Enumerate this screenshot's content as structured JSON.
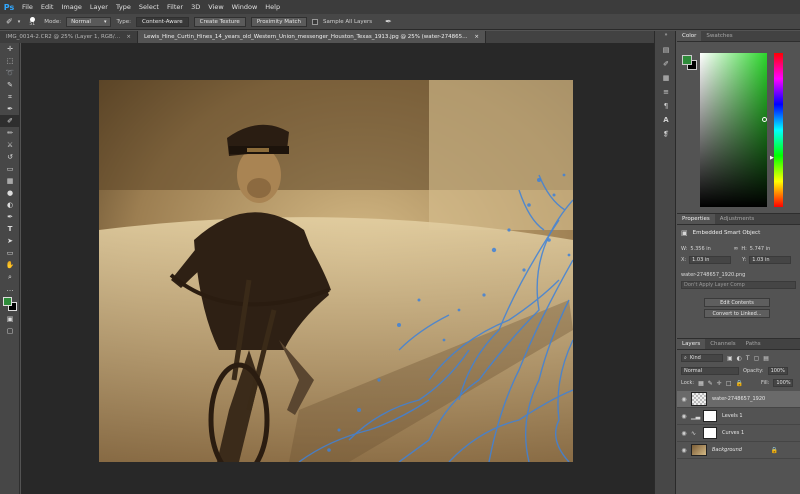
{
  "app": {
    "logo": "Ps",
    "menus": [
      "File",
      "Edit",
      "Image",
      "Layer",
      "Type",
      "Select",
      "Filter",
      "3D",
      "View",
      "Window",
      "Help"
    ]
  },
  "options_bar": {
    "brush_size": "51",
    "mode_label": "Mode:",
    "mode_value": "Normal",
    "type_label": "Type:",
    "type_buttons": [
      "Content-Aware",
      "Create Texture",
      "Proximity Match"
    ],
    "sample_all_layers": "Sample All Layers"
  },
  "tabs": [
    {
      "label": "IMG_0014-2.CR2 @ 25% (Layer 1, RGB/8*)",
      "active": false
    },
    {
      "label": "Lewis_Hine_Curtin_Hines_14_years_old_Western_Union_messenger_Houston_Texas_1913.jpg @ 25% (water-2748657_1920, RGB/8#) *",
      "active": true
    }
  ],
  "color_panel": {
    "tabs": [
      "Color",
      "Swatches"
    ],
    "foreground": "#2e8b3a",
    "background": "#000000"
  },
  "properties_panel": {
    "tabs": [
      "Properties",
      "Adjustments"
    ],
    "title": "Embedded Smart Object",
    "w_label": "W:",
    "w_value": "5.356 in",
    "h_label": "H:",
    "h_value": "5.747 in",
    "x_label": "X:",
    "x_value": "1.03 in",
    "y_label": "Y:",
    "y_value": "1.03 in",
    "filename": "water-2748657_1920.png",
    "layer_comp": "Don't Apply Layer Comp",
    "edit_contents": "Edit Contents",
    "convert": "Convert to Linked..."
  },
  "layers_panel": {
    "tabs": [
      "Layers",
      "Channels",
      "Paths"
    ],
    "kind_label": "Kind",
    "blend_mode": "Normal",
    "opacity_label": "Opacity:",
    "opacity_value": "100%",
    "lock_label": "Lock:",
    "fill_label": "Fill:",
    "fill_value": "100%",
    "layers": [
      {
        "name": "water-2748657_1920",
        "selected": true
      },
      {
        "name": "Levels 1",
        "selected": false
      },
      {
        "name": "Curves 1",
        "selected": false
      },
      {
        "name": "Background",
        "selected": false
      }
    ]
  }
}
